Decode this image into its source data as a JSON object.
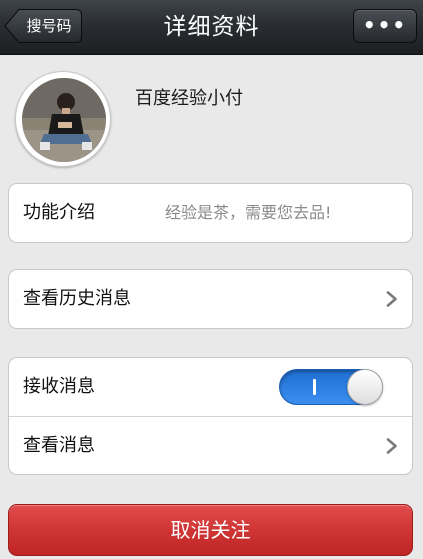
{
  "navbar": {
    "title": "详细资料",
    "back_label": "搜号码",
    "more_label": "•••"
  },
  "profile": {
    "name": "百度经验小付"
  },
  "intro_card": {
    "label": "功能介绍",
    "value": "经验是茶，需要您去品!"
  },
  "history_card": {
    "label": "查看历史消息"
  },
  "message_card": {
    "receive_label": "接收消息",
    "receive_enabled": true,
    "view_label": "查看消息"
  },
  "actions": {
    "unfollow_label": "取消关注"
  },
  "colors": {
    "navbar": "#2a2e32",
    "toggle_on": "#2f7fe4",
    "danger": "#d03535",
    "background": "#e9e9e9"
  }
}
